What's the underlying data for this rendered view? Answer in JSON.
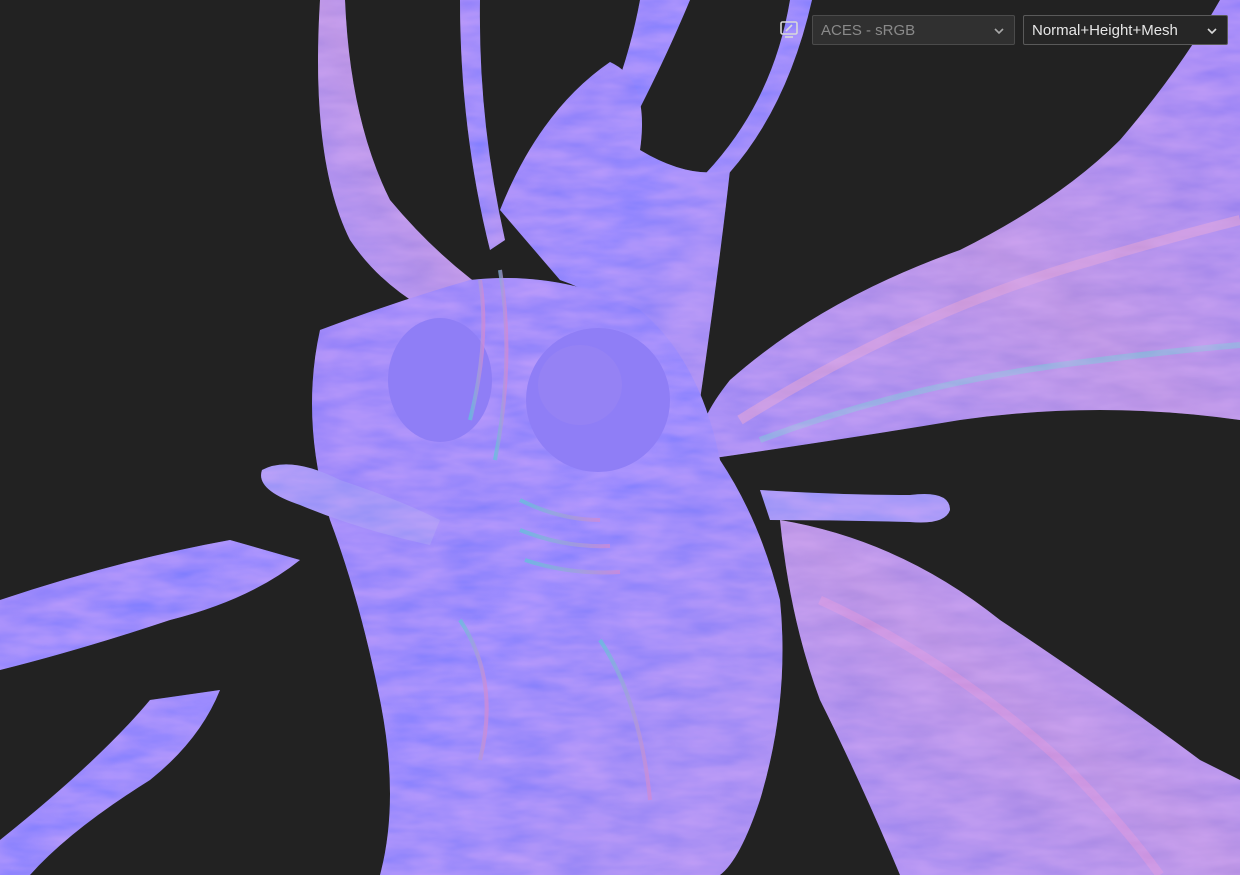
{
  "viewport": {
    "background": "#222222",
    "content": "normal-map preview"
  },
  "toolbar": {
    "display_icon": "monitor-pen-icon",
    "color_space": {
      "value": "ACES - sRGB"
    },
    "channel_mode": {
      "value": "Normal+Height+Mesh"
    },
    "dropdown_icon": "chevron-down-icon"
  },
  "colors": {
    "normal_base": "#7f7fff",
    "normal_light": "#9a8cf5",
    "normal_pink": "#c58ad8",
    "normal_teal": "#5fc6d6"
  }
}
